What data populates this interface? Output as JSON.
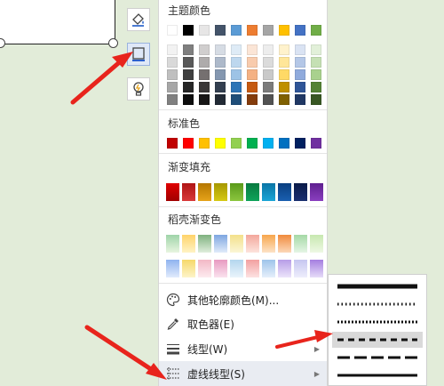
{
  "sections": {
    "theme": "主题颜色",
    "standard": "标准色",
    "gradient": "渐变填充",
    "daoke": "稻壳渐变色"
  },
  "theme_colors": {
    "top": [
      "#ffffff",
      "#000000",
      "#e7e6e6",
      "#44546a",
      "#5b9bd5",
      "#ed7d31",
      "#a5a5a5",
      "#ffc000",
      "#4472c4",
      "#70ad47"
    ],
    "shades": [
      [
        "#f2f2f2",
        "#7f7f7f",
        "#d0cece",
        "#d6dce4",
        "#deebf6",
        "#fbe5d6",
        "#ededed",
        "#fff2cc",
        "#dae3f3",
        "#e2f0d9"
      ],
      [
        "#d9d9d9",
        "#595959",
        "#aeabab",
        "#adb9ca",
        "#bdd7ee",
        "#f8cbad",
        "#dbdbdb",
        "#ffe699",
        "#b4c7e7",
        "#c5e0b4"
      ],
      [
        "#bfbfbf",
        "#3f3f3f",
        "#757070",
        "#8497b0",
        "#9dc3e6",
        "#f4b183",
        "#c9c9c9",
        "#ffd966",
        "#8faadc",
        "#a9d18e"
      ],
      [
        "#a6a6a6",
        "#262626",
        "#3a3838",
        "#333f50",
        "#2e75b6",
        "#c55a11",
        "#7b7b7b",
        "#bf9000",
        "#2f5597",
        "#548235"
      ],
      [
        "#808080",
        "#0d0d0d",
        "#171616",
        "#222a35",
        "#1f4e79",
        "#843c0c",
        "#525252",
        "#7f6000",
        "#203864",
        "#385723"
      ]
    ]
  },
  "standard_colors": [
    "#c00000",
    "#ff0000",
    "#ffc000",
    "#ffff00",
    "#92d050",
    "#00b050",
    "#00b0f0",
    "#0070c0",
    "#002060",
    "#7030a0"
  ],
  "gradient_colors": [
    [
      "#a00000",
      "#e00000"
    ],
    [
      "#d83a3a",
      "#b01515"
    ],
    [
      "#e6a31a",
      "#b57700"
    ],
    [
      "#d6c914",
      "#a69800"
    ],
    [
      "#8cc63f",
      "#5a9a1a"
    ],
    [
      "#0fa35a",
      "#087a40"
    ],
    [
      "#1aa5d6",
      "#0a75a6"
    ],
    [
      "#1a5fb0",
      "#0a3f80"
    ],
    [
      "#1a2f70",
      "#0a1a48"
    ],
    [
      "#8a3fbf",
      "#5f1f90"
    ]
  ],
  "daoke_colors": [
    [
      [
        "#9fd4a9",
        "#e8f5e0"
      ],
      [
        "#ffd36a",
        "#fff3c4"
      ],
      [
        "#7fb27f",
        "#dfeedc"
      ],
      [
        "#7ea6e0",
        "#e0ebfa"
      ],
      [
        "#f3e08a",
        "#fbf6d6"
      ],
      [
        "#f3a79c",
        "#fde4dd"
      ],
      [
        "#f7a64d",
        "#fde3c6"
      ],
      [
        "#f08a3d",
        "#fcd8b8"
      ],
      [
        "#a5d9a6",
        "#e5f5e5"
      ],
      [
        "#c7e8b0",
        "#eef8e4"
      ]
    ],
    [
      [
        "#8fb3ef",
        "#e1ebfc"
      ],
      [
        "#f6d86a",
        "#fdf4c9"
      ],
      [
        "#f2b8c6",
        "#fdebef"
      ],
      [
        "#e89ac1",
        "#fae2ee"
      ],
      [
        "#b4d6ee",
        "#eaf4fb"
      ],
      [
        "#f2a0a0",
        "#fde2e2"
      ],
      [
        "#9ec4ea",
        "#e6f0fb"
      ],
      [
        "#b79de6",
        "#ece4fa"
      ],
      [
        "#c6c6f0",
        "#eeeefc"
      ],
      [
        "#a57ee0",
        "#e6dcf8"
      ]
    ]
  ],
  "menu": {
    "more_colors": "其他轮廓颜色(M)...",
    "eyedropper": "取色器(E)",
    "line_type": "线型(W)",
    "dash_type": "虚线线型(S)"
  },
  "icons": {
    "fill": "paint-bucket-icon",
    "outline": "outline-square-icon",
    "effects": "lightbulb-icon",
    "palette": "palette-icon",
    "eyedropper": "eyedropper-icon",
    "line_type": "line-weight-icon",
    "dash": "dash-style-icon"
  },
  "dash_options": [
    "solid",
    "round-dot",
    "square-dot",
    "dash",
    "long-dash",
    "dash-dot"
  ],
  "selected_dash_index": 3,
  "accent": "#4a7bd2",
  "arrow_color": "#e8241c"
}
